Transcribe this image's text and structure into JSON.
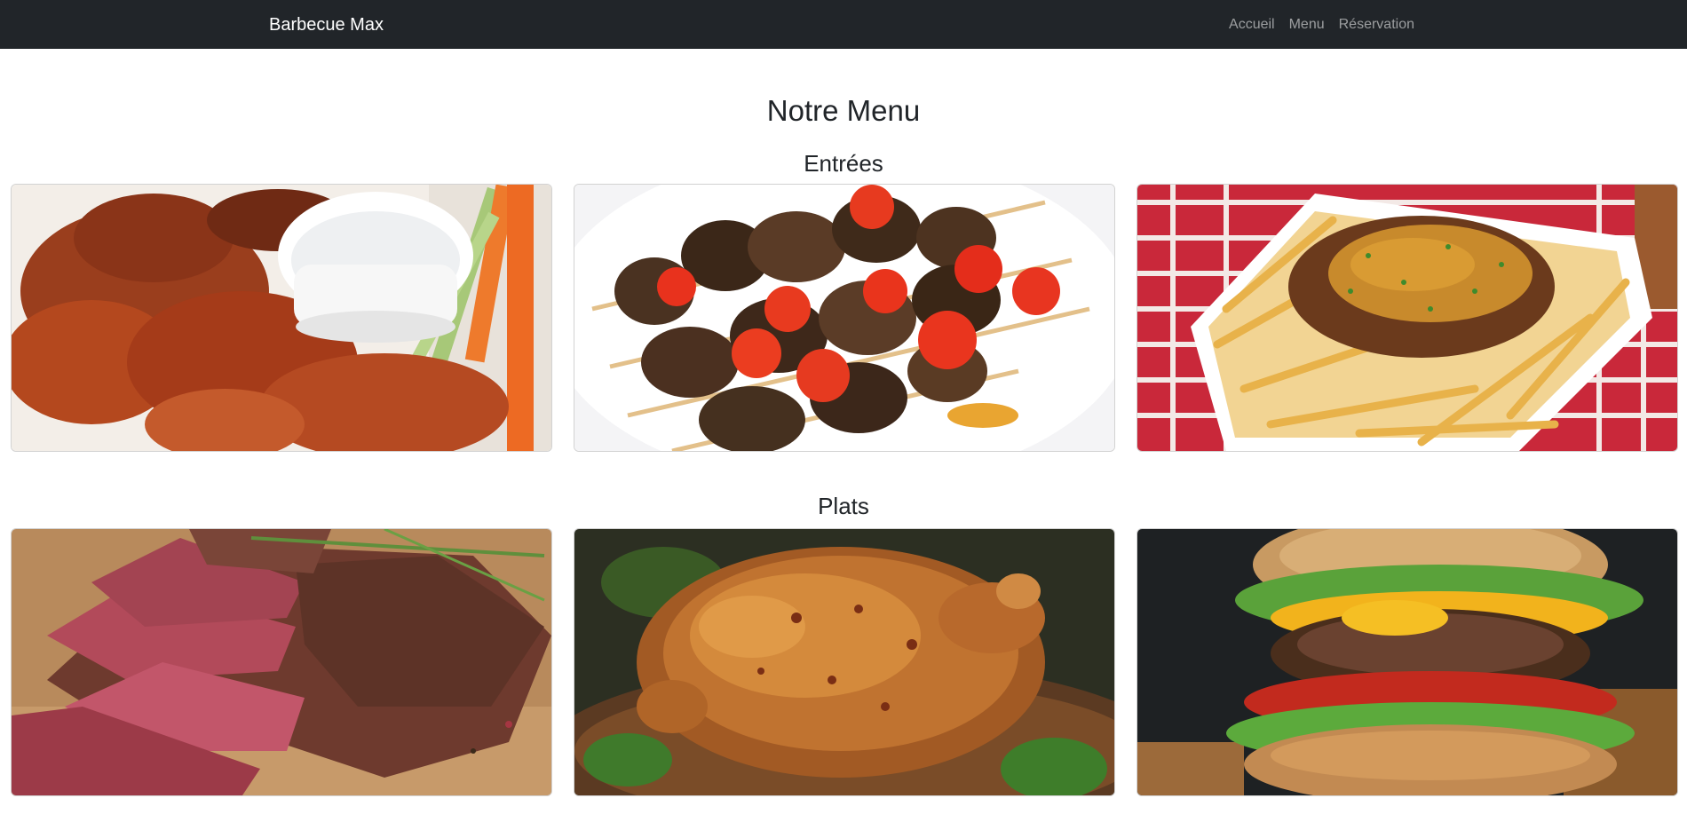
{
  "navbar": {
    "brand": "Barbecue Max",
    "links": [
      "Accueil",
      "Menu",
      "Réservation"
    ]
  },
  "page": {
    "title": "Notre Menu"
  },
  "sections": [
    {
      "title": "Entrées",
      "items": [
        {
          "icon": "chicken-wings-image"
        },
        {
          "icon": "brochettes-image"
        },
        {
          "icon": "poutine-fries-image"
        }
      ]
    },
    {
      "title": "Plats",
      "items": [
        {
          "icon": "steak-image"
        },
        {
          "icon": "roast-chicken-image"
        },
        {
          "icon": "burger-image"
        }
      ]
    }
  ]
}
